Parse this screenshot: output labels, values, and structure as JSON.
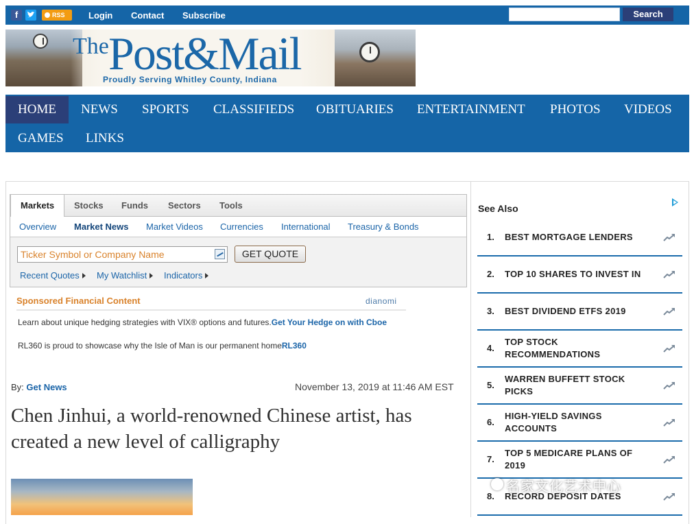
{
  "topbar": {
    "social": {
      "facebook": "f",
      "twitter": "t",
      "rss": "RSS"
    },
    "links": [
      "Login",
      "Contact",
      "Subscribe"
    ],
    "search": {
      "placeholder": "",
      "button": "Search"
    }
  },
  "masthead": {
    "logo_the": "The",
    "logo_main": "Post&Mail",
    "tagline": "Proudly Serving Whitley County, Indiana"
  },
  "nav": {
    "items": [
      "HOME",
      "NEWS",
      "SPORTS",
      "CLASSIFIEDS",
      "OBITUARIES",
      "ENTERTAINMENT",
      "PHOTOS",
      "VIDEOS",
      "GAMES",
      "LINKS"
    ],
    "active": "HOME"
  },
  "markets": {
    "tabs": [
      "Markets",
      "Stocks",
      "Funds",
      "Sectors",
      "Tools"
    ],
    "subtabs": [
      "Overview",
      "Market News",
      "Market Videos",
      "Currencies",
      "International",
      "Treasury & Bonds"
    ],
    "active_subtab": "Market News",
    "ticker_placeholder": "Ticker Symbol or Company Name",
    "quote_button": "GET QUOTE",
    "links": [
      "Recent Quotes",
      "My Watchlist",
      "Indicators"
    ]
  },
  "sponsored": {
    "title": "Sponsored Financial Content",
    "provider": "dianomi",
    "items": [
      {
        "text": "Learn about unique hedging strategies with VIX® options and futures.",
        "link": "Get Your Hedge on with Cboe"
      },
      {
        "text": "RL360 is proud to showcase why the Isle of Man is our permanent home",
        "link": "RL360"
      }
    ]
  },
  "article": {
    "by_label": "By:",
    "author": "Get News",
    "date": "November 13, 2019 at 11:46 AM EST",
    "headline": "Chen Jinhui, a world-renowned Chinese artist, has created a new level of calligraphy"
  },
  "see_also": {
    "title": "See Also",
    "items": [
      {
        "num": "1.",
        "label": "BEST MORTGAGE LENDERS"
      },
      {
        "num": "2.",
        "label": "TOP 10 SHARES TO INVEST IN"
      },
      {
        "num": "3.",
        "label": "BEST DIVIDEND ETFS 2019"
      },
      {
        "num": "4.",
        "label": "TOP STOCK RECOMMENDATIONS"
      },
      {
        "num": "5.",
        "label": "WARREN BUFFETT STOCK PICKS"
      },
      {
        "num": "6.",
        "label": "HIGH-YIELD SAVINGS ACCOUNTS"
      },
      {
        "num": "7.",
        "label": "TOP 5 MEDICARE PLANS OF 2019"
      },
      {
        "num": "8.",
        "label": "RECORD DEPOSIT DATES"
      }
    ]
  },
  "watermark": "名家文化艺术中心",
  "colors": {
    "brand_blue": "#1565a7",
    "nav_active": "#2b3f78",
    "link_blue": "#1a64a8",
    "orange": "#d9822b"
  }
}
